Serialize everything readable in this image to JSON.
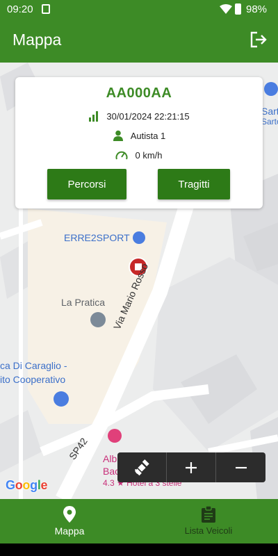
{
  "status_bar": {
    "time": "09:20",
    "battery": "98%"
  },
  "app_bar": {
    "title": "Mappa"
  },
  "vehicle_card": {
    "plate": "AA000AA",
    "datetime": "30/01/2024 22:21:15",
    "driver": "Autista 1",
    "speed": "0 km/h",
    "btn_routes": "Percorsi",
    "btn_trips": "Tragitti"
  },
  "map": {
    "poi_erre2sport": "ERRE2SPORT",
    "poi_la_pratica": "La Pratica",
    "street_mario_rosso": "Via Mario Rosso",
    "poi_bank_line1": "ca Di Caraglio -",
    "poi_bank_line2": "ito Cooperativo",
    "road_sp42": "SP42",
    "poi_hotel_name_1": "Alb",
    "poi_hotel_name_2": "Bac",
    "poi_hotel_rating": "4.3 ★ Hotel a 3 stelle",
    "poi_top_right_1": "Sart",
    "poi_top_right_2": "Sarto",
    "google_logo": "Google"
  },
  "bottom_nav": {
    "items": [
      {
        "label": "Mappa",
        "icon": "map-pin-icon",
        "active": true
      },
      {
        "label": "Lista Veicoli",
        "icon": "clipboard-icon",
        "active": false
      }
    ]
  },
  "colors": {
    "primary": "#3d8b26",
    "button": "#2d7a17",
    "marker": "#c62828"
  }
}
